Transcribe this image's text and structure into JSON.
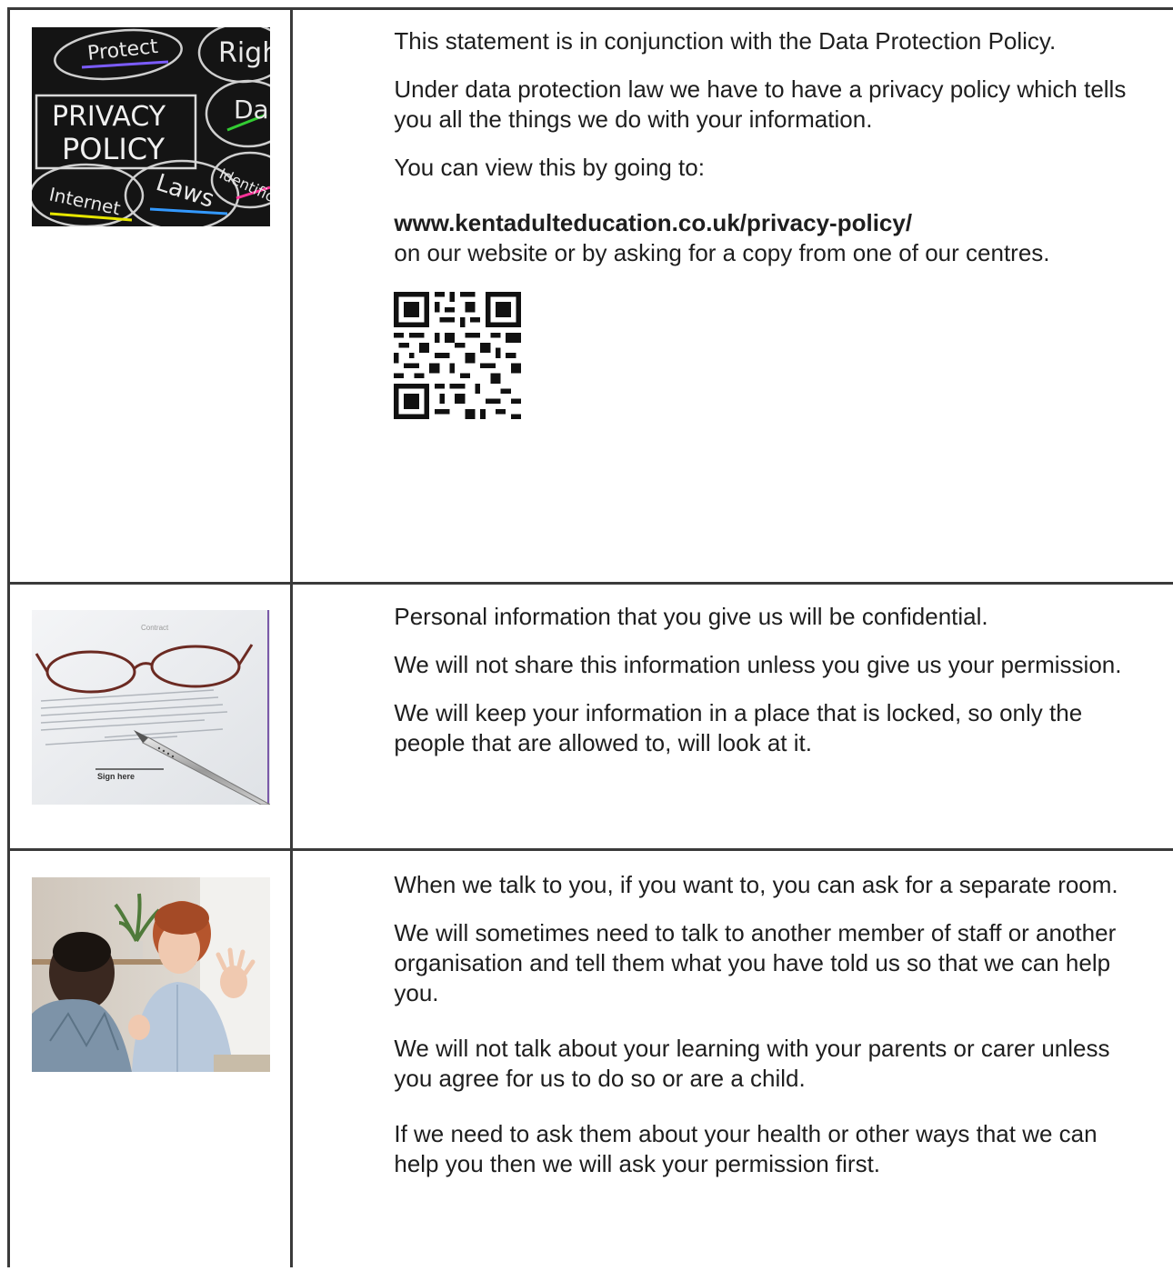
{
  "section1": {
    "image": {
      "words": [
        "Protect",
        "Righ",
        "PRIVACY",
        "POLICY",
        "Da",
        "Identific",
        "Internet",
        "Laws"
      ]
    },
    "paragraphs": [
      "This statement is in conjunction with the Data Protection Policy.",
      "Under data protection law we have to have a privacy policy which tells you all the things we do with your information.",
      "You can view this by going to:"
    ],
    "link_text": "www.kentadulteducation.co.uk/privacy-policy/",
    "after_link": "on our website or by asking for a copy from one of our centres."
  },
  "section2": {
    "image": {
      "words": [
        "Contract",
        "Sign here"
      ]
    },
    "paragraphs": [
      "Personal information that you give us will be confidential.",
      "We will not share this information unless you give us your permission.",
      "We will keep your information in a place that is locked, so only the people that are allowed to, will look at it."
    ]
  },
  "section3": {
    "paragraphs": [
      "When we talk to you, if you want to, you can ask for a separate room.",
      "We will sometimes need to talk to another member of staff or another organisation and tell them what you have told us so that we can help you.",
      "We will not talk about your learning with your parents or carer unless you agree for us to do so or are a child.",
      "If we need to ask them about your health or other ways that we can help you then we will ask your permission first."
    ]
  }
}
